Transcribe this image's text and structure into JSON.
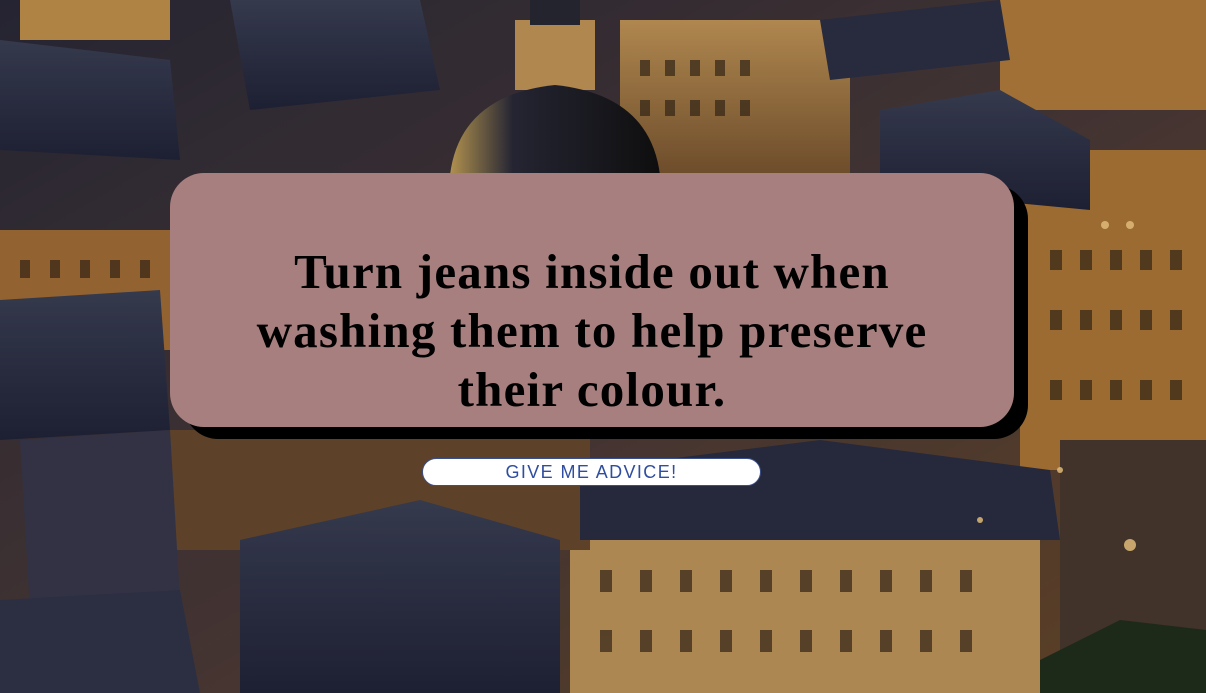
{
  "advice": {
    "text": "Turn jeans inside out when washing them to help preserve their colour."
  },
  "button": {
    "label": "GIVE ME ADVICE!"
  },
  "colors": {
    "card_background": "#a87f7f",
    "card_shadow": "#000000",
    "button_background": "#ffffff",
    "button_text": "#2f4ea0"
  }
}
